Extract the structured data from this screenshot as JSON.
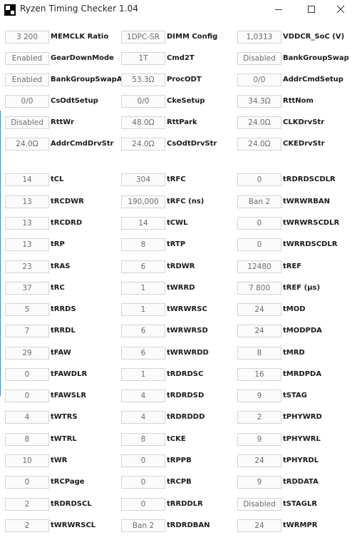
{
  "window": {
    "title": "Ryzen Timing Checker 1.04",
    "icons": {
      "app": "app-logo-icon",
      "minimize": "minimize-icon",
      "maximize": "maximize-icon",
      "close": "close-icon"
    }
  },
  "rows": [
    [
      {
        "value": "3 200",
        "label": "MEMCLK Ratio"
      },
      {
        "value": "1DPC-SR",
        "label": "DIMM Config"
      },
      {
        "value": "1,0313",
        "label": "VDDCR_SoC (V)"
      }
    ],
    [
      {
        "value": "Enabled",
        "label": "GearDownMode"
      },
      {
        "value": "1T",
        "label": "Cmd2T"
      },
      {
        "value": "Disabled",
        "label": "BankGroupSwap"
      }
    ],
    [
      {
        "value": "Enabled",
        "label": "BankGroupSwapAlt"
      },
      {
        "value": "53.3Ω",
        "label": "ProcODT"
      },
      {
        "value": "0/0",
        "label": "AddrCmdSetup"
      }
    ],
    [
      {
        "value": "0/0",
        "label": "CsOdtSetup"
      },
      {
        "value": "0/0",
        "label": "CkeSetup"
      },
      {
        "value": "34.3Ω",
        "label": "RttNom"
      }
    ],
    [
      {
        "value": "Disabled",
        "label": "RttWr"
      },
      {
        "value": "48.0Ω",
        "label": "RttPark"
      },
      {
        "value": "24.0Ω",
        "label": "CLKDrvStr"
      }
    ],
    [
      {
        "value": "24.0Ω",
        "label": "AddrCmdDrvStr"
      },
      {
        "value": "24.0Ω",
        "label": "CsOdtDrvStr"
      },
      {
        "value": "24.0Ω",
        "label": "CKEDrvStr"
      }
    ],
    [
      {
        "value": "14",
        "label": "tCL"
      },
      {
        "value": "304",
        "label": "tRFC"
      },
      {
        "value": "0",
        "label": "tRDRDSCDLR"
      }
    ],
    [
      {
        "value": "13",
        "label": "tRCDWR"
      },
      {
        "value": "190,000",
        "label": "tRFC (ns)"
      },
      {
        "value": "Ban 2",
        "label": "tWRWRBAN"
      }
    ],
    [
      {
        "value": "13",
        "label": "tRCDRD"
      },
      {
        "value": "14",
        "label": "tCWL"
      },
      {
        "value": "0",
        "label": "tWRWRSCDLR"
      }
    ],
    [
      {
        "value": "13",
        "label": "tRP"
      },
      {
        "value": "8",
        "label": "tRTP"
      },
      {
        "value": "0",
        "label": "tWRRDSCDLR"
      }
    ],
    [
      {
        "value": "23",
        "label": "tRAS"
      },
      {
        "value": "6",
        "label": "tRDWR"
      },
      {
        "value": "12480",
        "label": "tREF"
      }
    ],
    [
      {
        "value": "37",
        "label": "tRC"
      },
      {
        "value": "1",
        "label": "tWRRD"
      },
      {
        "value": "7 800",
        "label": "tREF (µs)"
      }
    ],
    [
      {
        "value": "5",
        "label": "tRRDS"
      },
      {
        "value": "1",
        "label": "tWRWRSC"
      },
      {
        "value": "24",
        "label": "tMOD"
      }
    ],
    [
      {
        "value": "7",
        "label": "tRRDL"
      },
      {
        "value": "6",
        "label": "tWRWRSD"
      },
      {
        "value": "24",
        "label": "tMODPDA"
      }
    ],
    [
      {
        "value": "29",
        "label": "tFAW"
      },
      {
        "value": "6",
        "label": "tWRWRDD"
      },
      {
        "value": "8",
        "label": "tMRD"
      }
    ],
    [
      {
        "value": "0",
        "label": "tFAWDLR"
      },
      {
        "value": "1",
        "label": "tRDRDSC"
      },
      {
        "value": "16",
        "label": "tMRDPDA"
      }
    ],
    [
      {
        "value": "0",
        "label": "tFAWSLR"
      },
      {
        "value": "4",
        "label": "tRDRDSD"
      },
      {
        "value": "9",
        "label": "tSTAG"
      }
    ],
    [
      {
        "value": "4",
        "label": "tWTRS"
      },
      {
        "value": "4",
        "label": "tRDRDDD"
      },
      {
        "value": "2",
        "label": "tPHYWRD"
      }
    ],
    [
      {
        "value": "8",
        "label": "tWTRL"
      },
      {
        "value": "8",
        "label": "tCKE"
      },
      {
        "value": "9",
        "label": "tPHYWRL"
      }
    ],
    [
      {
        "value": "10",
        "label": "tWR"
      },
      {
        "value": "0",
        "label": "tRPPB"
      },
      {
        "value": "24",
        "label": "tPHYRDL"
      }
    ],
    [
      {
        "value": "0",
        "label": "tRCPage"
      },
      {
        "value": "0",
        "label": "tRCPB"
      },
      {
        "value": "9",
        "label": "tRDDATA"
      }
    ],
    [
      {
        "value": "2",
        "label": "tRDRDSCL"
      },
      {
        "value": "0",
        "label": "tRRDDLR"
      },
      {
        "value": "Disabled",
        "label": "tSTAGLR"
      }
    ],
    [
      {
        "value": "2",
        "label": "tWRWRSCL"
      },
      {
        "value": "Ban 2",
        "label": "tRDRDBAN"
      },
      {
        "value": "24",
        "label": "tWRMPR"
      }
    ]
  ]
}
